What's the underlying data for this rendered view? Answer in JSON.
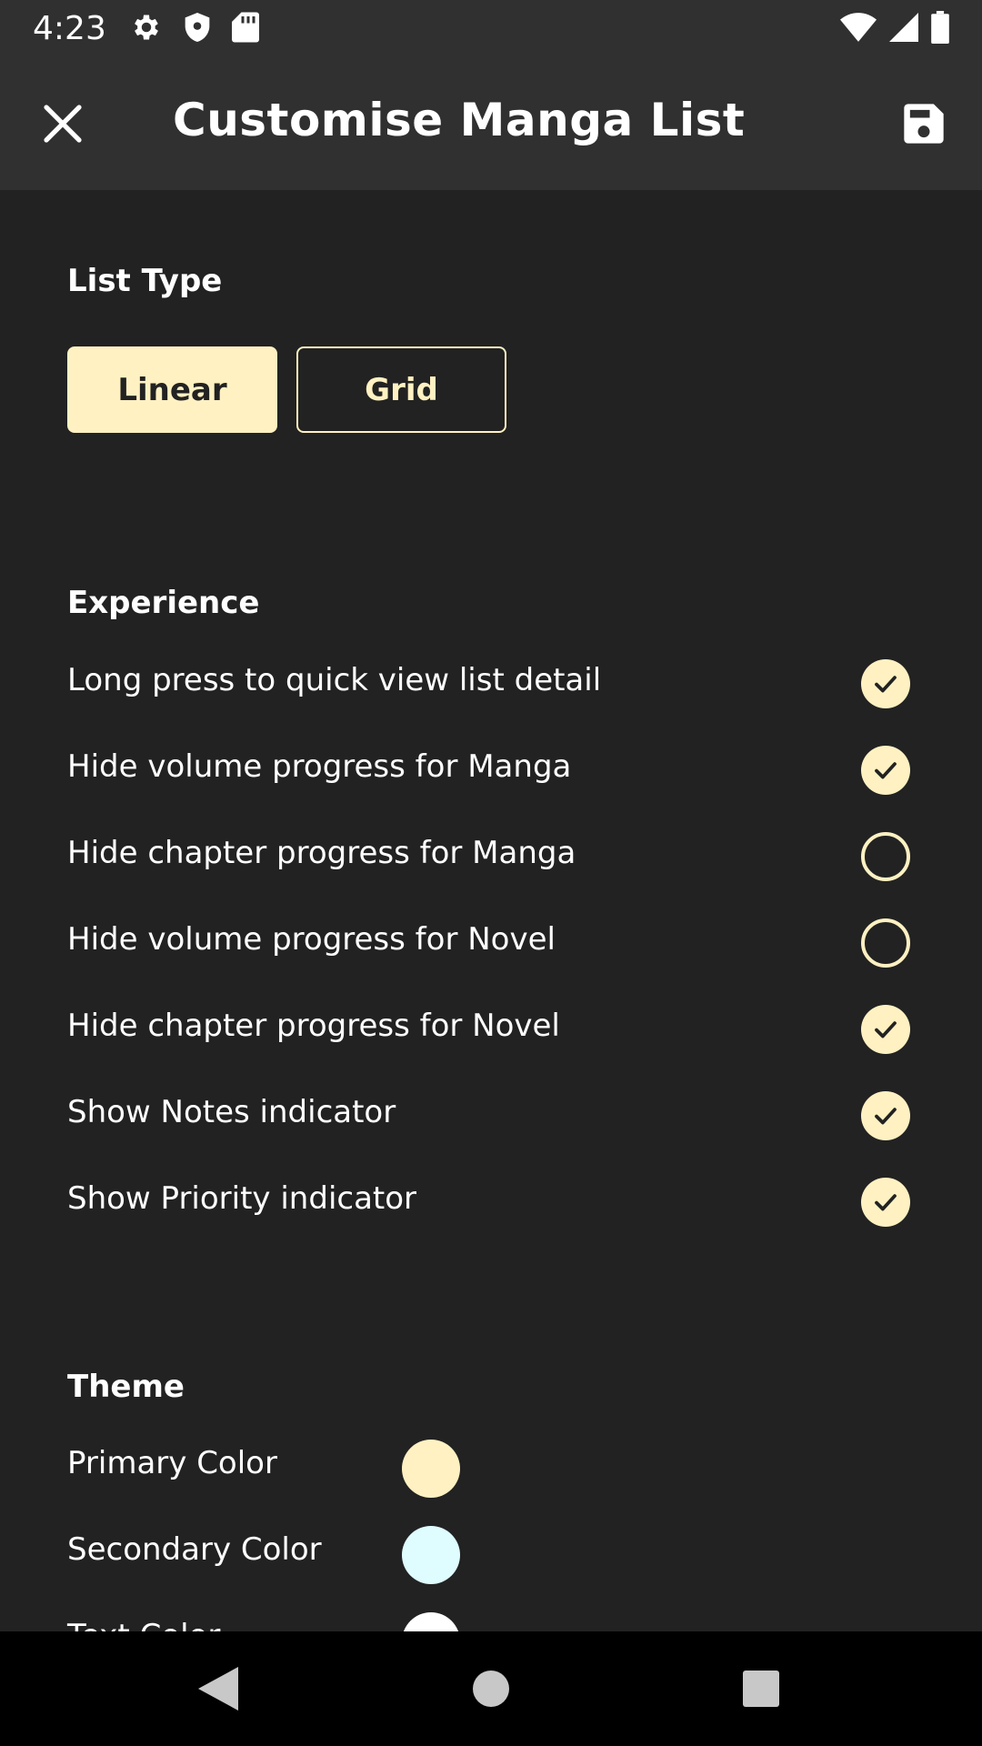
{
  "status_bar": {
    "time": "4:23",
    "left_icons": [
      "gear-icon",
      "shield-icon",
      "sd-card-icon"
    ],
    "right_icons": [
      "wifi-icon",
      "signal-icon",
      "battery-icon"
    ]
  },
  "app_bar": {
    "title": "Customise Manga List",
    "close_icon": "close-icon",
    "save_icon": "save-icon"
  },
  "list_type": {
    "title": "List Type",
    "options": [
      {
        "label": "Linear",
        "selected": true
      },
      {
        "label": "Grid",
        "selected": false
      }
    ]
  },
  "experience": {
    "title": "Experience",
    "items": [
      {
        "label": "Long press to quick view list detail",
        "checked": true
      },
      {
        "label": "Hide volume progress for Manga",
        "checked": true
      },
      {
        "label": "Hide chapter progress for Manga",
        "checked": false
      },
      {
        "label": "Hide volume progress for Novel",
        "checked": false
      },
      {
        "label": "Hide chapter progress for Novel",
        "checked": true
      },
      {
        "label": "Show Notes indicator",
        "checked": true
      },
      {
        "label": "Show Priority indicator",
        "checked": true
      }
    ]
  },
  "theme": {
    "title": "Theme",
    "colors": [
      {
        "label": "Primary Color",
        "value": "#fff1c2"
      },
      {
        "label": "Secondary Color",
        "value": "#dffcff"
      },
      {
        "label": "Text Color",
        "value": "#ffffff"
      }
    ]
  },
  "colors": {
    "accent": "#fff1c2",
    "background": "#222222",
    "bar": "#303030"
  },
  "nav_bar": {
    "icons": [
      "back-icon",
      "home-icon",
      "recents-icon"
    ]
  }
}
